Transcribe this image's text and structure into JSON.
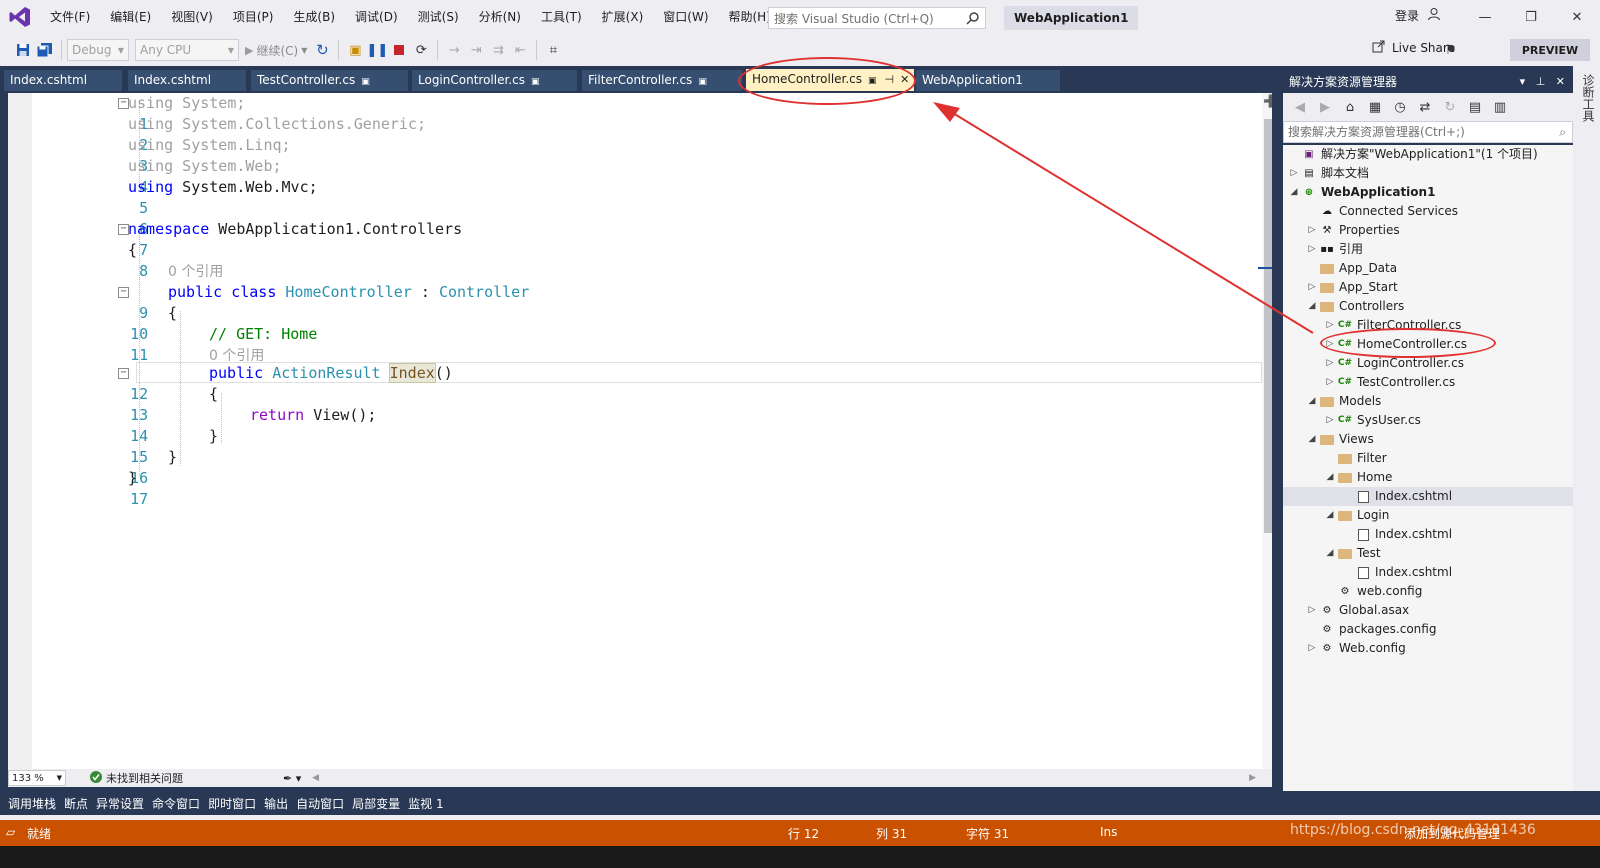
{
  "menu": {
    "items": [
      "文件(F)",
      "编辑(E)",
      "视图(V)",
      "项目(P)",
      "生成(B)",
      "调试(D)",
      "测试(S)",
      "分析(N)",
      "工具(T)",
      "扩展(X)",
      "窗口(W)",
      "帮助(H)"
    ],
    "search_placeholder": "搜索 Visual Studio (Ctrl+Q)",
    "project_name": "WebApplication1",
    "login": "登录"
  },
  "toolbar": {
    "config": "Debug",
    "platform": "Any CPU",
    "continue_label": "继续(C)",
    "liveshare": "Live Share",
    "preview": "PREVIEW"
  },
  "tabs": [
    {
      "label": "Index.cshtml"
    },
    {
      "label": "Index.cshtml"
    },
    {
      "label": "TestController.cs"
    },
    {
      "label": "LoginController.cs"
    },
    {
      "label": "FilterController.cs"
    },
    {
      "label": "HomeController.cs"
    },
    {
      "label": "WebApplication1"
    }
  ],
  "code": {
    "l1_kw": "using",
    "l1_rest": " System;",
    "l2_kw": "using",
    "l2_rest": " System.Collections.Generic;",
    "l3_kw": "using",
    "l3_rest": " System.Linq;",
    "l4_kw": "using",
    "l4_rest": " System.Web;",
    "l5_kw": "using",
    "l5_rest": " System.Web.Mvc;",
    "l7_kw": "namespace",
    "l7_rest": " WebApplication1.Controllers",
    "brace_open": "{",
    "brace_close": "}",
    "ref_hint": "0 个引用",
    "l9_kw": "public class",
    "l9_type": "HomeController",
    "l9_colon": " : ",
    "l9_base": "Controller",
    "l11_comment": "// GET: Home",
    "l12_kw": "public",
    "l12_type": "ActionResult",
    "l12_method": "Index",
    "l12_paren": "()",
    "l14_kw": "return",
    "l14_rest": " View();"
  },
  "line_numbers": [
    "1",
    "2",
    "3",
    "4",
    "5",
    "6",
    "7",
    "8",
    "9",
    "10",
    "11",
    "12",
    "13",
    "14",
    "15",
    "16",
    "17"
  ],
  "editor_status": {
    "zoom": "133 %",
    "issues": "未找到相关问题"
  },
  "tool_tabs": [
    "调用堆栈",
    "断点",
    "异常设置",
    "命令窗口",
    "即时窗口",
    "输出",
    "自动窗口",
    "局部变量",
    "监视 1"
  ],
  "statusbar": {
    "ready": "就绪",
    "row": "行 12",
    "col": "列 31",
    "char": "字符 31",
    "ins": "Ins",
    "source_control": "添加到源代码管理"
  },
  "solution_explorer": {
    "title": "解决方案资源管理器",
    "search_placeholder": "搜索解决方案资源管理器(Ctrl+;)",
    "side_tab": "诊断工具",
    "nodes": [
      {
        "label": "解决方案\"WebApplication1\"(1 个项目)"
      },
      {
        "label": "脚本文档"
      },
      {
        "label": "WebApplication1"
      },
      {
        "label": "Connected Services"
      },
      {
        "label": "Properties"
      },
      {
        "label": "引用"
      },
      {
        "label": "App_Data"
      },
      {
        "label": "App_Start"
      },
      {
        "label": "Controllers"
      },
      {
        "label": "FilterController.cs"
      },
      {
        "label": "HomeController.cs"
      },
      {
        "label": "LoginController.cs"
      },
      {
        "label": "TestController.cs"
      },
      {
        "label": "Models"
      },
      {
        "label": "SysUser.cs"
      },
      {
        "label": "Views"
      },
      {
        "label": "Filter"
      },
      {
        "label": "Home"
      },
      {
        "label": "Index.cshtml"
      },
      {
        "label": "Login"
      },
      {
        "label": "Index.cshtml"
      },
      {
        "label": "Test"
      },
      {
        "label": "Index.cshtml"
      },
      {
        "label": "web.config"
      },
      {
        "label": "Global.asax"
      },
      {
        "label": "packages.config"
      },
      {
        "label": "Web.config"
      }
    ]
  },
  "watermark": "https://blog.csdn.net/qq_43191436",
  "colors": {
    "accent_blue": "#293955",
    "status_orange": "#ca5100",
    "annotation_red": "#e03131",
    "active_tab": "#fff1c4"
  }
}
